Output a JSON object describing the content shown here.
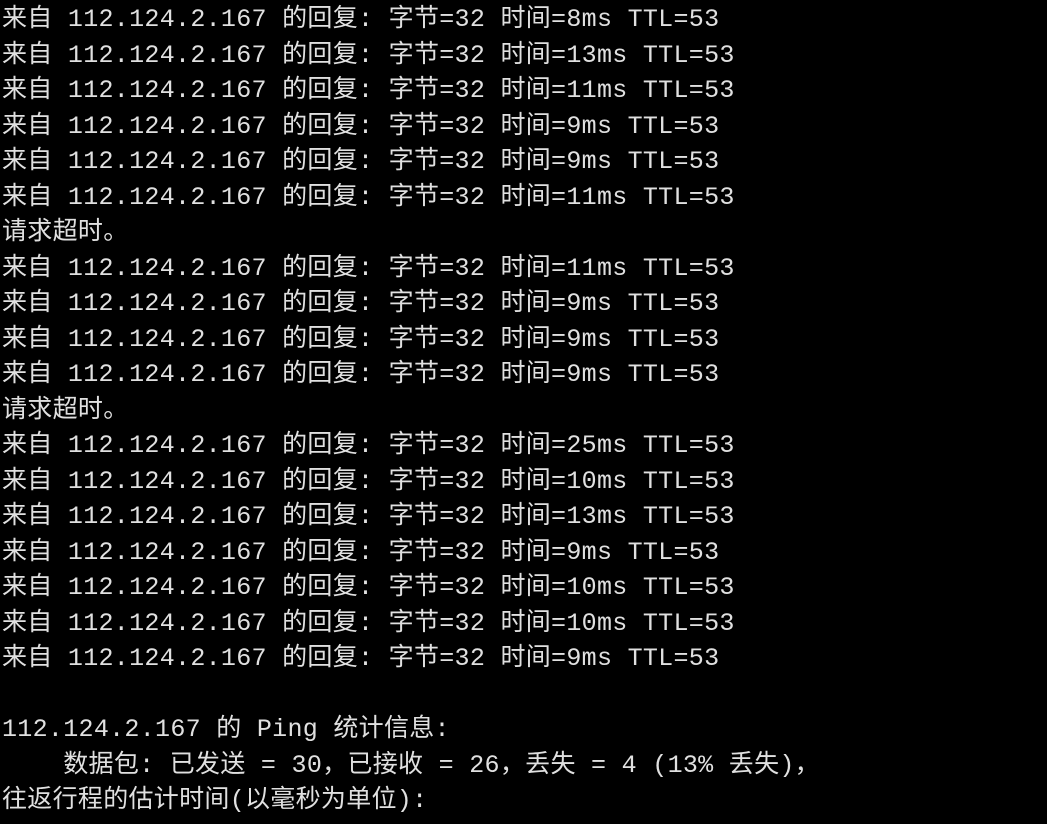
{
  "ping": {
    "lines": [
      {
        "type": "reply",
        "ip": "112.124.2.167",
        "bytes": 32,
        "time": "8ms",
        "ttl": 53
      },
      {
        "type": "reply",
        "ip": "112.124.2.167",
        "bytes": 32,
        "time": "13ms",
        "ttl": 53
      },
      {
        "type": "reply",
        "ip": "112.124.2.167",
        "bytes": 32,
        "time": "11ms",
        "ttl": 53
      },
      {
        "type": "reply",
        "ip": "112.124.2.167",
        "bytes": 32,
        "time": "9ms",
        "ttl": 53
      },
      {
        "type": "reply",
        "ip": "112.124.2.167",
        "bytes": 32,
        "time": "9ms",
        "ttl": 53
      },
      {
        "type": "reply",
        "ip": "112.124.2.167",
        "bytes": 32,
        "time": "11ms",
        "ttl": 53
      },
      {
        "type": "timeout"
      },
      {
        "type": "reply",
        "ip": "112.124.2.167",
        "bytes": 32,
        "time": "11ms",
        "ttl": 53
      },
      {
        "type": "reply",
        "ip": "112.124.2.167",
        "bytes": 32,
        "time": "9ms",
        "ttl": 53
      },
      {
        "type": "reply",
        "ip": "112.124.2.167",
        "bytes": 32,
        "time": "9ms",
        "ttl": 53
      },
      {
        "type": "reply",
        "ip": "112.124.2.167",
        "bytes": 32,
        "time": "9ms",
        "ttl": 53
      },
      {
        "type": "timeout"
      },
      {
        "type": "reply",
        "ip": "112.124.2.167",
        "bytes": 32,
        "time": "25ms",
        "ttl": 53
      },
      {
        "type": "reply",
        "ip": "112.124.2.167",
        "bytes": 32,
        "time": "10ms",
        "ttl": 53
      },
      {
        "type": "reply",
        "ip": "112.124.2.167",
        "bytes": 32,
        "time": "13ms",
        "ttl": 53
      },
      {
        "type": "reply",
        "ip": "112.124.2.167",
        "bytes": 32,
        "time": "9ms",
        "ttl": 53
      },
      {
        "type": "reply",
        "ip": "112.124.2.167",
        "bytes": 32,
        "time": "10ms",
        "ttl": 53
      },
      {
        "type": "reply",
        "ip": "112.124.2.167",
        "bytes": 32,
        "time": "10ms",
        "ttl": 53
      },
      {
        "type": "reply",
        "ip": "112.124.2.167",
        "bytes": 32,
        "time": "9ms",
        "ttl": 53
      }
    ],
    "labels": {
      "reply_prefix": "来自",
      "reply_mid": "的回复:",
      "bytes_label": "字节",
      "time_label": "时间",
      "ttl_label": "TTL",
      "timeout_text": "请求超时。"
    },
    "stats": {
      "header": "112.124.2.167 的 Ping 统计信息:",
      "packets_line": "数据包: 已发送 = 30，已接收 = 26，丢失 = 4 (13% 丢失)，",
      "rtt_header": "往返行程的估计时间(以毫秒为单位):",
      "ip": "112.124.2.167",
      "sent": 30,
      "received": 26,
      "lost": 4,
      "loss_percent": "13%"
    }
  }
}
